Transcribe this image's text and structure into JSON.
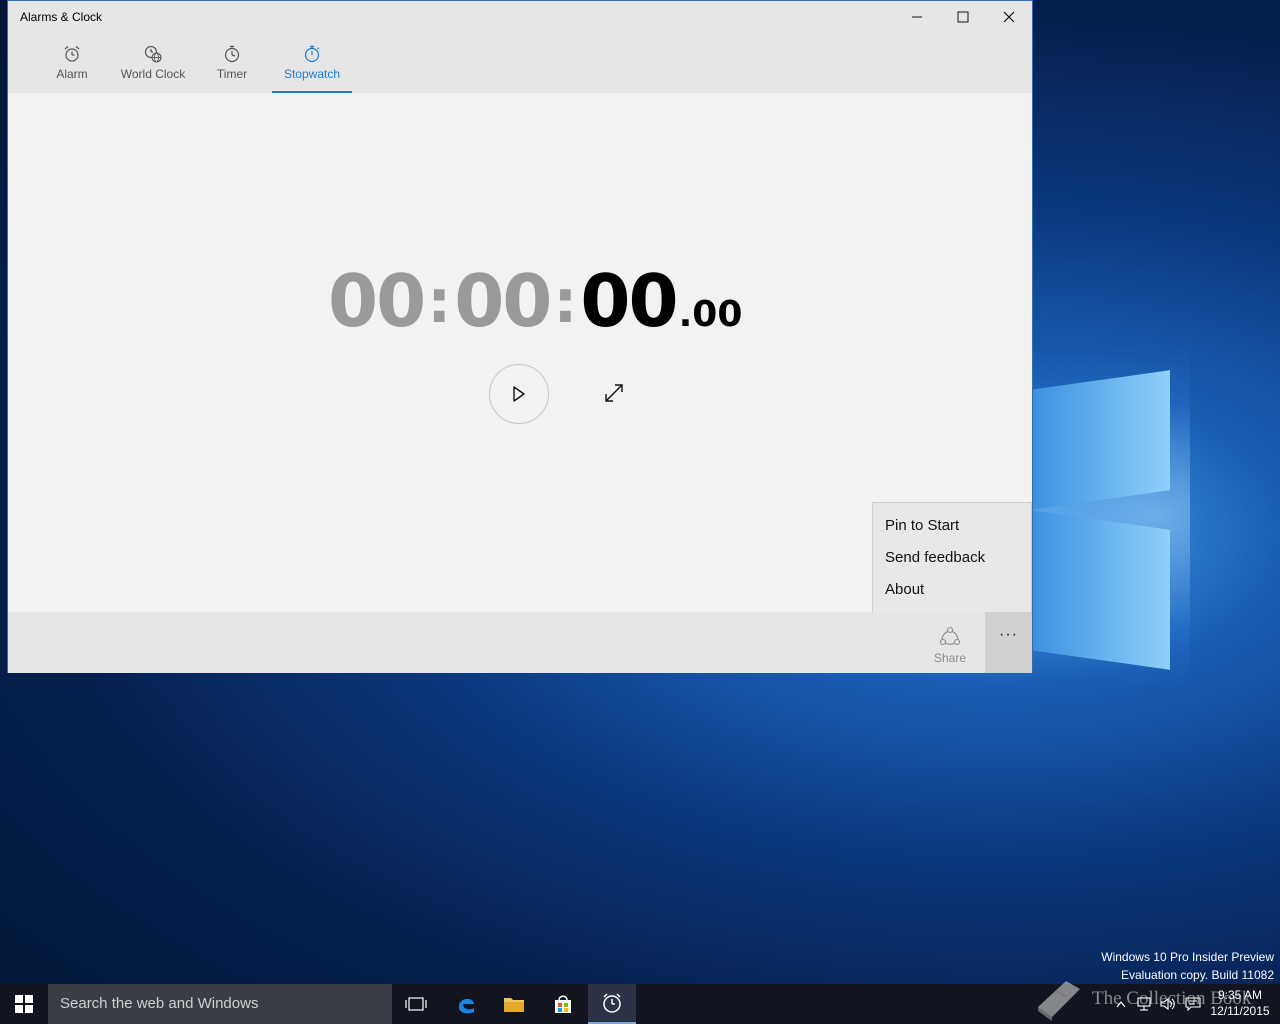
{
  "window": {
    "title": "Alarms & Clock",
    "controls": {
      "minimize": "—",
      "maximize": "☐",
      "close": "✕"
    }
  },
  "tabs": [
    {
      "label": "Alarm",
      "icon": "alarm-clock-icon",
      "active": false
    },
    {
      "label": "World Clock",
      "icon": "world-clock-icon",
      "active": false
    },
    {
      "label": "Timer",
      "icon": "timer-icon",
      "active": false
    },
    {
      "label": "Stopwatch",
      "icon": "stopwatch-icon",
      "active": true
    }
  ],
  "stopwatch": {
    "hours": "00",
    "minutes": "00",
    "seconds": "00",
    "fraction": ".00",
    "separator": ":",
    "play_icon": "play-icon",
    "expand_icon": "expand-icon"
  },
  "menu": {
    "items": [
      "Pin to Start",
      "Send feedback",
      "About"
    ]
  },
  "appbar": {
    "share_label": "Share",
    "more_label": "···"
  },
  "desktop": {
    "watermark_line1": "Windows 10 Pro Insider Preview",
    "watermark_line2": "Evaluation copy. Build 11082",
    "brand_text": "The Collection Book"
  },
  "taskbar": {
    "search_placeholder": "Search the web and Windows",
    "time": "9:35 AM",
    "date": "12/11/2015"
  },
  "colors": {
    "accent": "#1c7bd0",
    "titlebar": "#e6e6e6",
    "content": "#f2f2f2",
    "taskbar": "#121520"
  }
}
